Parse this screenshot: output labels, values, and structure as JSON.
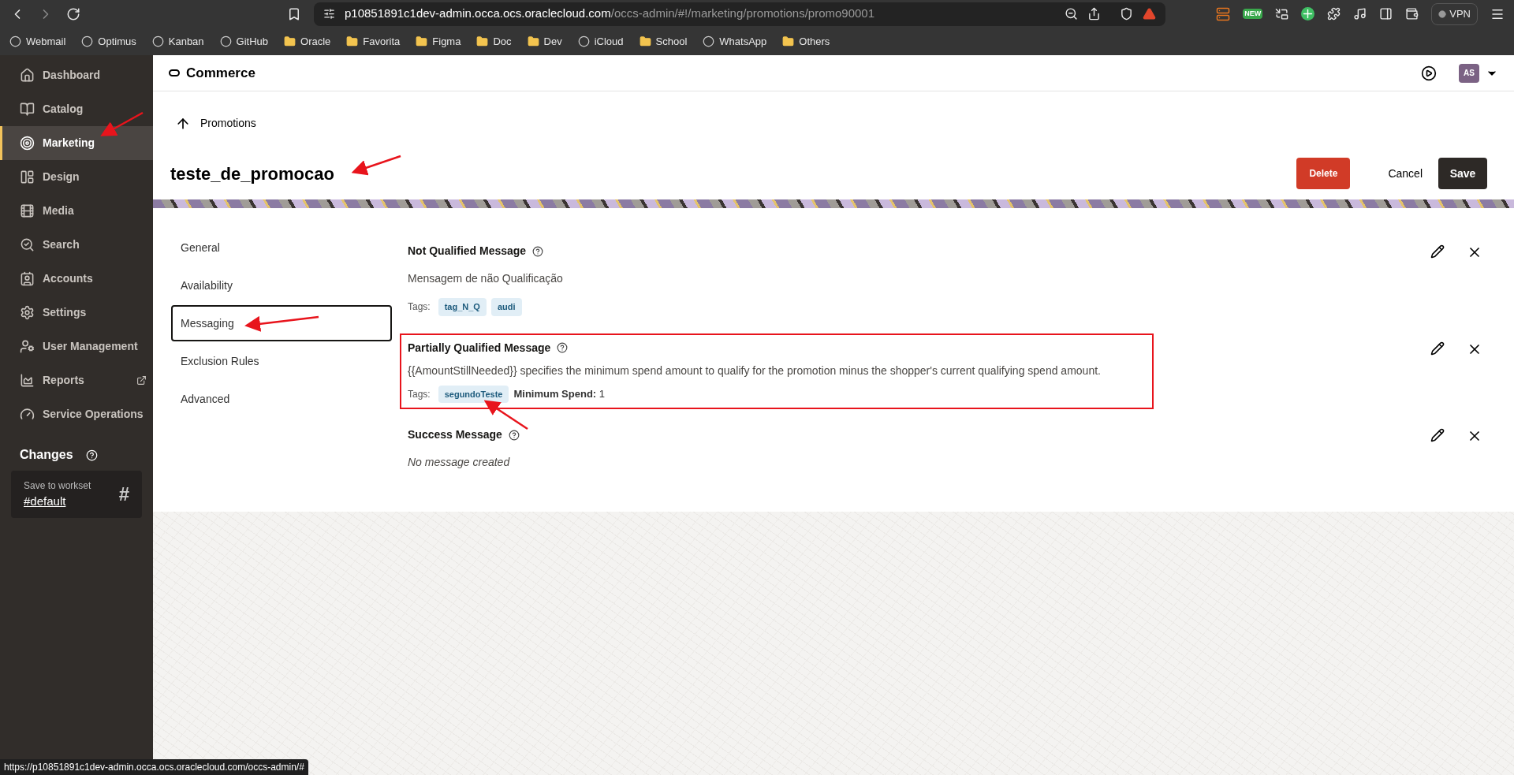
{
  "browser": {
    "url": {
      "host": "p10851891c1dev-admin.occa.ocs.oraclecloud.com",
      "path": "/occs-admin/#!/marketing/promotions/promo90001"
    },
    "extension_badge": "NEW",
    "vpn": "VPN",
    "bookmarks": [
      {
        "label": "Webmail",
        "kind": "site"
      },
      {
        "label": "Optimus",
        "kind": "site"
      },
      {
        "label": "Kanban",
        "kind": "site"
      },
      {
        "label": "GitHub",
        "kind": "site"
      },
      {
        "label": "Oracle",
        "kind": "folder"
      },
      {
        "label": "Favorita",
        "kind": "folder"
      },
      {
        "label": "Figma",
        "kind": "folder"
      },
      {
        "label": "Doc",
        "kind": "folder"
      },
      {
        "label": "Dev",
        "kind": "folder"
      },
      {
        "label": "iCloud",
        "kind": "site"
      },
      {
        "label": "School",
        "kind": "folder"
      },
      {
        "label": "WhatsApp",
        "kind": "site"
      },
      {
        "label": "Others",
        "kind": "folder"
      }
    ]
  },
  "sidebar": {
    "items": [
      {
        "label": "Dashboard",
        "selected": false,
        "external": false
      },
      {
        "label": "Catalog",
        "selected": false,
        "external": false
      },
      {
        "label": "Marketing",
        "selected": true,
        "external": false
      },
      {
        "label": "Design",
        "selected": false,
        "external": false
      },
      {
        "label": "Media",
        "selected": false,
        "external": false
      },
      {
        "label": "Search",
        "selected": false,
        "external": false
      },
      {
        "label": "Accounts",
        "selected": false,
        "external": false
      },
      {
        "label": "Settings",
        "selected": false,
        "external": false
      },
      {
        "label": "User Management",
        "selected": false,
        "external": false
      },
      {
        "label": "Reports",
        "selected": false,
        "external": true
      },
      {
        "label": "Service Operations",
        "selected": false,
        "external": false
      }
    ],
    "changes": {
      "title": "Changes",
      "caption": "Save to workset",
      "workset": "#default",
      "symbol": "#"
    }
  },
  "header": {
    "app": "Commerce",
    "avatar": "AS"
  },
  "breadcrumb": "Promotions",
  "title": "teste_de_promocao",
  "actions": {
    "delete": "Delete",
    "cancel": "Cancel",
    "save": "Save"
  },
  "sections": [
    {
      "label": "General",
      "selected": false
    },
    {
      "label": "Availability",
      "selected": false
    },
    {
      "label": "Messaging",
      "selected": true
    },
    {
      "label": "Exclusion Rules",
      "selected": false
    },
    {
      "label": "Advanced",
      "selected": false
    }
  ],
  "messages": [
    {
      "title": "Not Qualified Message",
      "body": "Mensagem de não Qualificação",
      "empty": false,
      "highlighted": false,
      "tags_label": "Tags:",
      "tags": [
        "tag_N_Q",
        "audi"
      ]
    },
    {
      "title": "Partially Qualified Message",
      "body": "{{AmountStillNeeded}} specifies the minimum spend amount to qualify for the promotion minus the shopper's current qualifying spend amount.",
      "empty": false,
      "highlighted": true,
      "tags_label": "Tags:",
      "tags": [
        "segundoTeste"
      ],
      "minimum_spend": {
        "label": "Minimum Spend:",
        "value": "1"
      }
    },
    {
      "title": "Success Message",
      "body": "No message created",
      "empty": true,
      "highlighted": false
    }
  ],
  "status_url": "https://p10851891c1dev-admin.occa.ocs.oraclecloud.com/occs-admin/#"
}
